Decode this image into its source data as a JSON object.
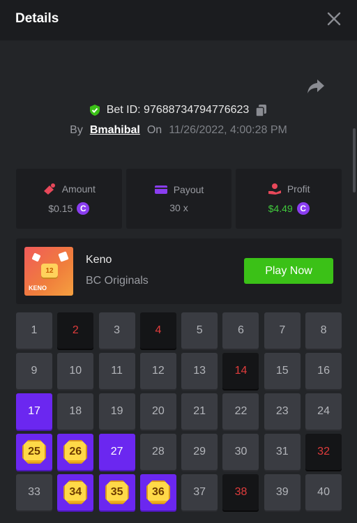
{
  "header": {
    "title": "Details"
  },
  "bet": {
    "id_label": "Bet ID: 97688734794776623",
    "by_label": "By",
    "user": "Bmahibal",
    "on_label": "On",
    "date": "11/26/2022, 4:00:28 PM"
  },
  "stats": {
    "amount": {
      "label": "Amount",
      "value": "$0.15"
    },
    "payout": {
      "label": "Payout",
      "value": "30 x"
    },
    "profit": {
      "label": "Profit",
      "value": "$4.49"
    }
  },
  "game": {
    "name": "Keno",
    "provider": "BC Originals",
    "thumb_number": "12",
    "thumb_text": "KENO",
    "play_label": "Play Now"
  },
  "grid": {
    "numbers": [
      1,
      2,
      3,
      4,
      5,
      6,
      7,
      8,
      9,
      10,
      11,
      12,
      13,
      14,
      15,
      16,
      17,
      18,
      19,
      20,
      21,
      22,
      23,
      24,
      25,
      26,
      27,
      28,
      29,
      30,
      31,
      32,
      33,
      34,
      35,
      36,
      37,
      38,
      39,
      40
    ],
    "drawn_miss": [
      2,
      4,
      14,
      32,
      38
    ],
    "selected": [
      17,
      27
    ],
    "hits": [
      25,
      26,
      34,
      35,
      36
    ]
  },
  "colors": {
    "accent": "#6b27f0",
    "green": "#3bc117",
    "red": "#e03c3c",
    "gold": "#ffd948"
  }
}
